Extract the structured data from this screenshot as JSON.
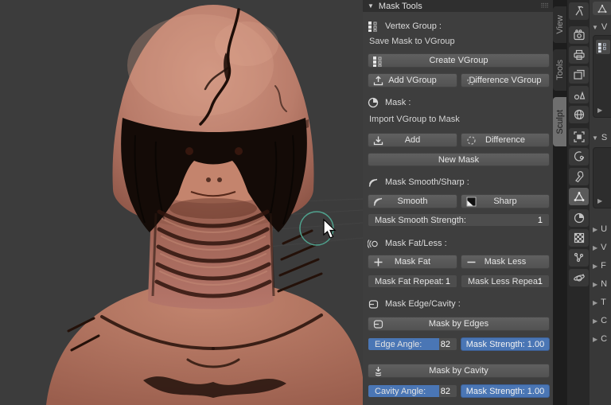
{
  "colors": {
    "accent_blue": "#4a76b5",
    "slider_track": "#4f4f4f",
    "brush_cursor": "#4fa18d",
    "panel_bg": "#3e3e3e",
    "header_bg": "#2f2f2f",
    "viewport_bg": "#3c3c3c",
    "skin": "#b97c6a"
  },
  "mask_tools": {
    "title": "Mask Tools",
    "vertex_group": {
      "section_label": "Vertex Group :",
      "save_text": "Save Mask to VGroup",
      "create_button": "Create VGroup",
      "add_button": "Add VGroup",
      "difference_button": "Difference VGroup"
    },
    "mask": {
      "section_label": "Mask :",
      "import_text": "Import VGroup to Mask",
      "add_button": "Add",
      "difference_button": "Difference",
      "new_mask_button": "New Mask"
    },
    "smooth_sharp": {
      "section_label": "Mask Smooth/Sharp :",
      "smooth_button": "Smooth",
      "sharp_button": "Sharp",
      "strength_label": "Mask Smooth Strength:",
      "strength_value": "1"
    },
    "fat_less": {
      "section_label": "Mask Fat/Less :",
      "fat_button": "Mask Fat",
      "less_button": "Mask Less",
      "fat_repeat_label": "Mask Fat Repeat:",
      "fat_repeat_value": "1",
      "less_repeat_label": "Mask Less Repea:",
      "less_repeat_value": "1"
    },
    "edge_cavity": {
      "section_label": "Mask Edge/Cavity :",
      "by_edges_button": "Mask by Edges",
      "edge_angle_label": "Edge Angle:",
      "edge_angle_value": "82",
      "edge_strength_text": "Mask Strength: 1.00",
      "by_cavity_button": "Mask by Cavity",
      "cavity_angle_label": "Cavity Angle:",
      "cavity_angle_value": "82",
      "cavity_strength_text": "Mask Strength: 1.00"
    }
  },
  "sidebar_tabs": [
    {
      "label": "View",
      "active": false
    },
    {
      "label": "Tools",
      "active": false
    },
    {
      "label": "Sculpt",
      "active": true
    }
  ],
  "properties_rail": {
    "icons": [
      "tool",
      "render",
      "output",
      "view-layer",
      "scene",
      "world",
      "object",
      "constraints",
      "modifiers",
      "object-data",
      "material",
      "texture",
      "particles",
      "physics"
    ],
    "active_icon": "object-data"
  },
  "properties_panel": {
    "vertex_groups_header": "V",
    "shape_keys_header": "S",
    "collapsed_sections": [
      "U",
      "V",
      "F",
      "N",
      "T",
      "C",
      "C"
    ]
  }
}
